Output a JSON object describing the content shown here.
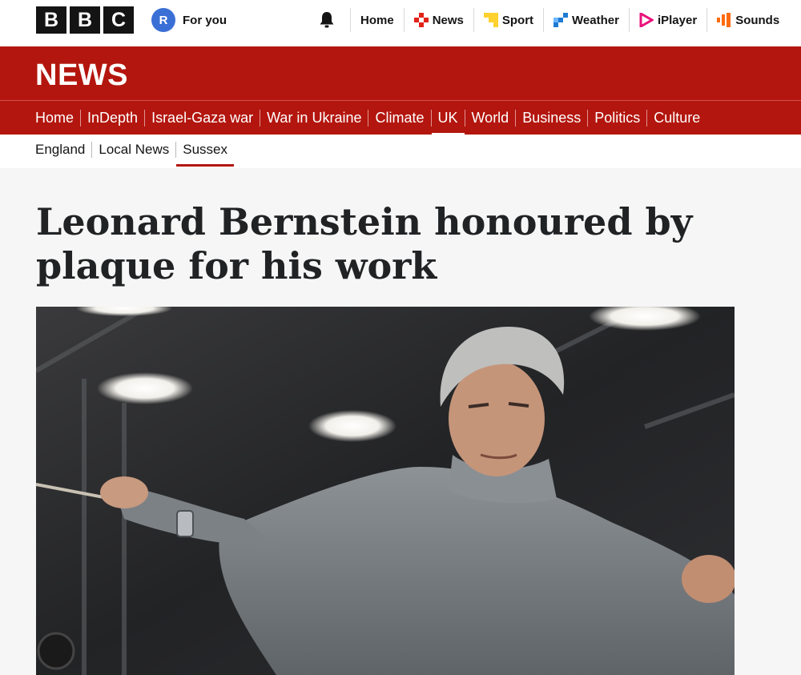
{
  "brand": {
    "letters": [
      "B",
      "B",
      "C"
    ]
  },
  "account": {
    "initial": "R",
    "label": "For you"
  },
  "top_nav": [
    {
      "label": "Home",
      "icon": "none"
    },
    {
      "label": "News",
      "icon": "news-icon",
      "color": "#e2231a"
    },
    {
      "label": "Sport",
      "icon": "sport-icon",
      "color": "#ffd230"
    },
    {
      "label": "Weather",
      "icon": "weather-icon",
      "color": "#1f7bd1"
    },
    {
      "label": "iPlayer",
      "icon": "iplayer-icon",
      "color": "#e8127c"
    },
    {
      "label": "Sounds",
      "icon": "sounds-icon",
      "color": "#ff6b0f"
    }
  ],
  "section": {
    "title": "NEWS",
    "color": "#b3160e"
  },
  "main_nav": [
    "Home",
    "InDepth",
    "Israel-Gaza war",
    "War in Ukraine",
    "Climate",
    "UK",
    "World",
    "Business",
    "Politics",
    "Culture"
  ],
  "main_nav_active": "UK",
  "sub_nav": [
    "England",
    "Local News",
    "Sussex"
  ],
  "sub_nav_active": "Sussex",
  "article": {
    "headline_line1": "Leonard Bernstein honoured by",
    "headline_line2": "plaque for his work"
  }
}
